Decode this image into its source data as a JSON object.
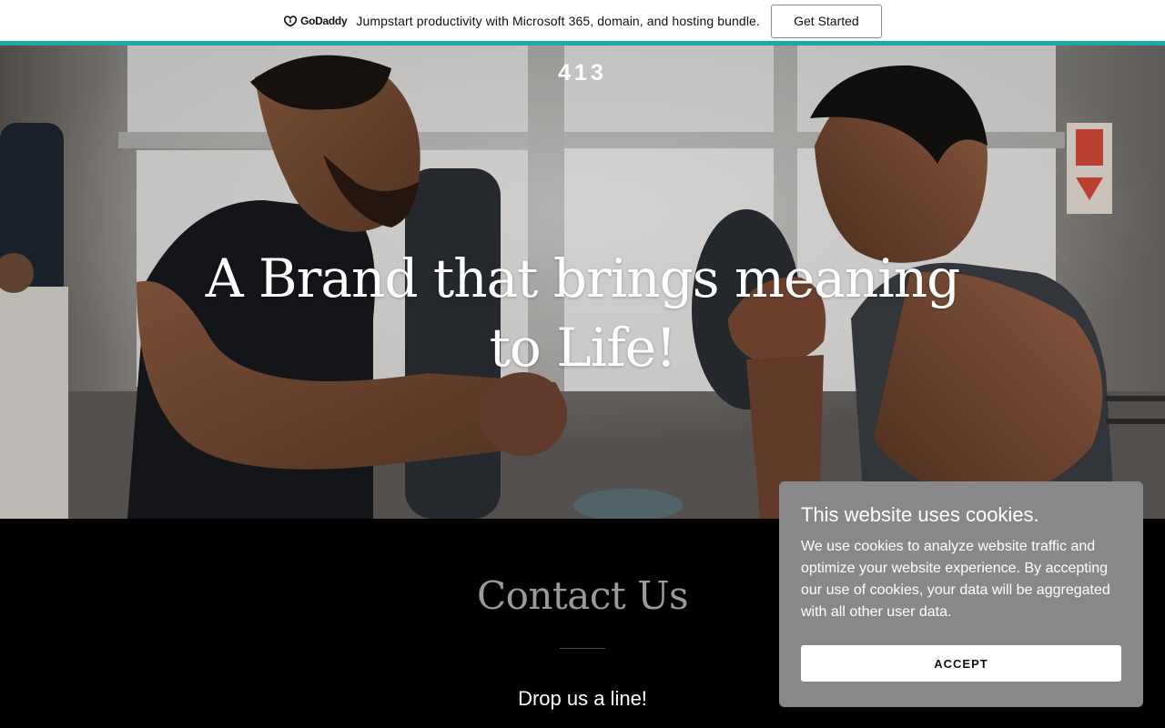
{
  "promo": {
    "logo_text": "GoDaddy",
    "message": "Jumpstart productivity with Microsoft 365, domain, and hosting bundle.",
    "cta_label": "Get Started",
    "accent_color": "#1ba8a8"
  },
  "hero": {
    "site_title": "413",
    "headline": "A Brand that brings meaning to Life!",
    "image": "two-men-boxing-gym-photo"
  },
  "contact": {
    "title": "Contact Us",
    "subtitle": "Drop us a line!"
  },
  "cookie_banner": {
    "title": "This website uses cookies.",
    "body": "We use cookies to analyze website traffic and optimize your website experience. By accepting our use of cookies, your data will be aggregated with all other user data.",
    "accept_label": "ACCEPT",
    "background_color": "#888888"
  }
}
